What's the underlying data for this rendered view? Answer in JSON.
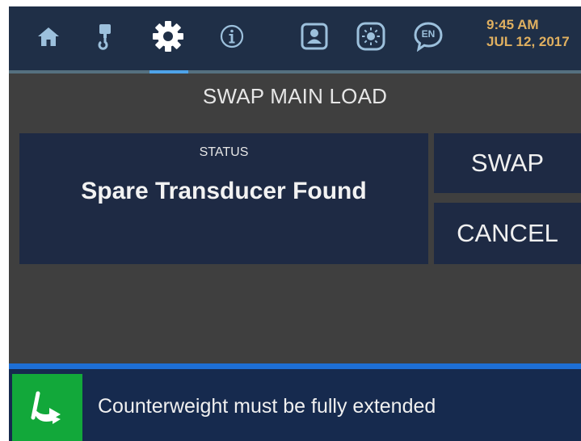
{
  "nav": {
    "items": [
      {
        "icon": "home-icon"
      },
      {
        "icon": "hook-icon"
      },
      {
        "icon": "gear-icon",
        "active": true
      },
      {
        "icon": "info-icon"
      },
      {
        "icon": "operator-icon"
      },
      {
        "icon": "brightness-icon"
      },
      {
        "icon": "language-icon",
        "text": "EN"
      }
    ],
    "time": "9:45 AM",
    "date": "JUL 12, 2017"
  },
  "page": {
    "title": "SWAP MAIN LOAD"
  },
  "status": {
    "label": "STATUS",
    "value": "Spare Transducer Found"
  },
  "actions": {
    "swap_label": "SWAP",
    "cancel_label": "CANCEL"
  },
  "alert": {
    "message": "Counterweight must be fully extended",
    "icon": "counterweight-extend-arrow-icon"
  },
  "colors": {
    "background": "#3f3f3f",
    "navbar": "#1f2f47",
    "panel": "#1e2a44",
    "accent_active": "#4ea3e8",
    "clock": "#e0b060",
    "alert_bar": "#162a4e",
    "alert_line": "#1e6fd6",
    "alert_icon": "#12a83a"
  }
}
